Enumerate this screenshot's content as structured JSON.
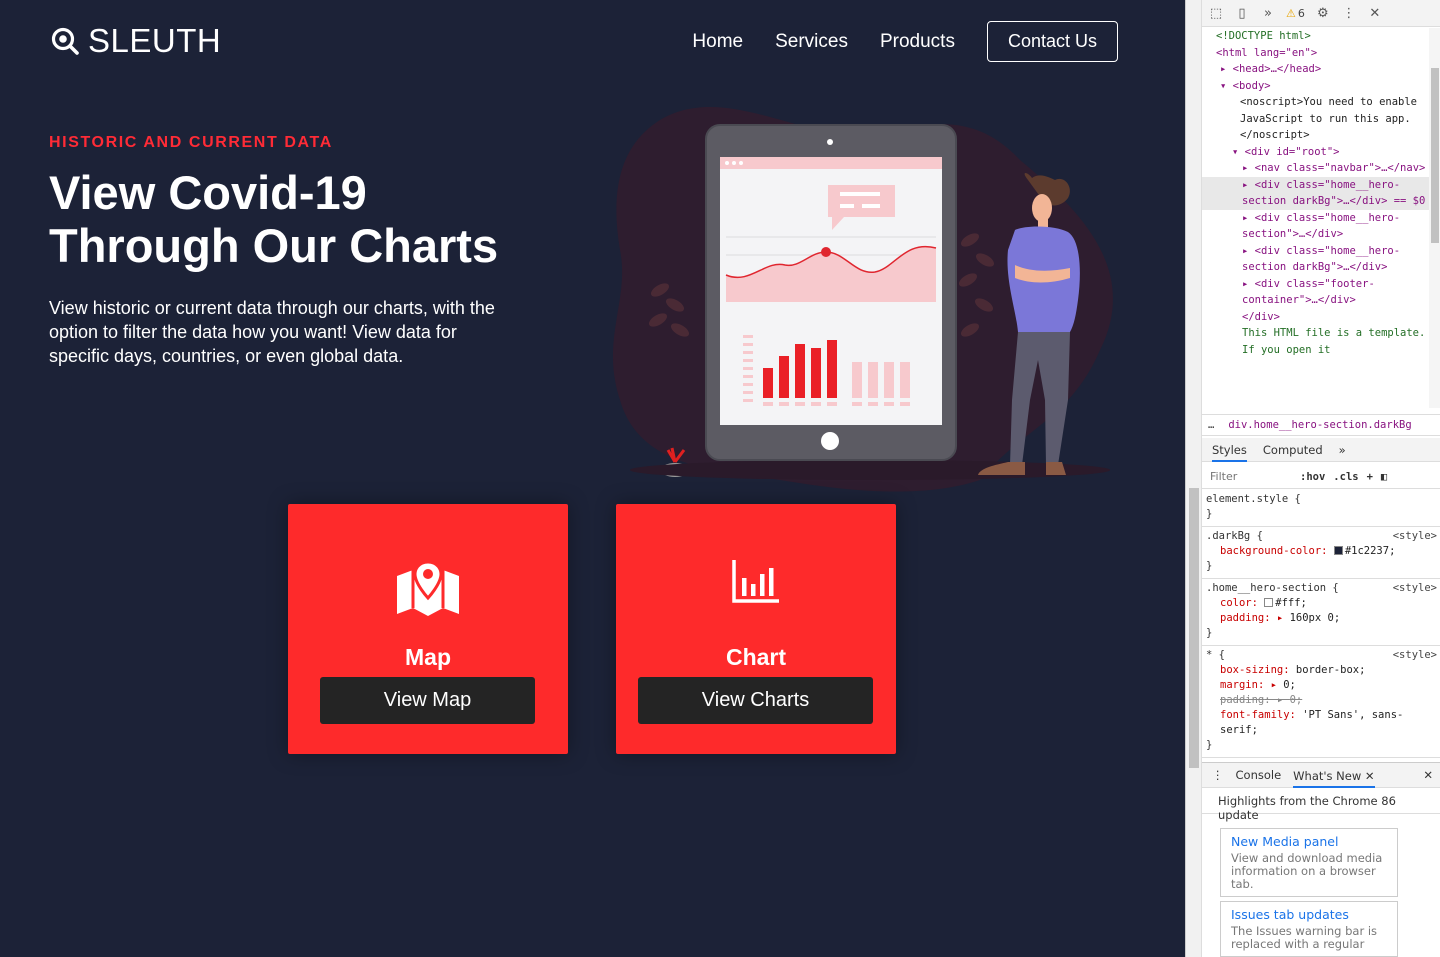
{
  "site": {
    "logo": "SLEUTH",
    "nav": {
      "items": [
        "Home",
        "Services",
        "Products"
      ],
      "contact": "Contact Us"
    },
    "hero": {
      "eyebrow": "HISTORIC AND CURRENT DATA",
      "headline": "View Covid-19 Through Our Charts",
      "description": "View historic or current data through our charts, with the option to filter the data how you want! View data for specific days, countries, or even global data."
    },
    "cards": [
      {
        "title": "Map",
        "button": "View Map",
        "icon": "map-pin-icon"
      },
      {
        "title": "Chart",
        "button": "View Charts",
        "icon": "bar-chart-icon"
      }
    ],
    "colors": {
      "background": "#1c2237",
      "accent": "#fe2a2b",
      "eyebrow": "#ff2b36",
      "button": "#242424"
    }
  },
  "devtools": {
    "warnings": "6",
    "elements": [
      "<!DOCTYPE html>",
      "<html lang=\"en\">",
      "<head>…</head>",
      "<body>",
      "<noscript>You need to enable JavaScript to run this app.</noscript>",
      "<div id=\"root\">",
      "<nav class=\"navbar\">…</nav>",
      "<div class=\"home__hero-section darkBg\">…</div> == $0",
      "<div class=\"home__hero-section\">…</div>",
      "<div class=\"home__hero-section darkBg\">…</div>",
      "<div class=\"footer-container\">…</div>",
      "</div>",
      "This HTML file is a template. If you open it"
    ],
    "breadcrumb": "div.home__hero-section.darkBg",
    "tabs": [
      "Styles",
      "Computed"
    ],
    "filter_placeholder": "Filter",
    "filter_buttons": [
      ":hov",
      ".cls"
    ],
    "rules": [
      {
        "selector": "element.style {",
        "source": ""
      },
      {
        "selector": ".darkBg {",
        "source": "<style>",
        "props": [
          [
            "background-color",
            "#1c2237;"
          ]
        ]
      },
      {
        "selector": ".home__hero-section {",
        "source": "<style>",
        "props": [
          [
            "color",
            "#fff;"
          ],
          [
            "padding",
            "160px 0;"
          ]
        ]
      },
      {
        "selector": "* {",
        "source": "<style>",
        "props": [
          [
            "box-sizing",
            "border-box;"
          ],
          [
            "margin",
            "0;"
          ],
          [
            "padding",
            "0;"
          ],
          [
            "font-family",
            "'PT Sans', sans-serif;"
          ]
        ]
      }
    ],
    "drawer_tabs": [
      "Console",
      "What's New"
    ],
    "highlights": "Highlights from the Chrome 86 update",
    "news": [
      {
        "title": "New Media panel",
        "desc": "View and download media information on a browser tab."
      },
      {
        "title": "Issues tab updates",
        "desc": "The Issues warning bar is replaced with a regular"
      }
    ]
  }
}
